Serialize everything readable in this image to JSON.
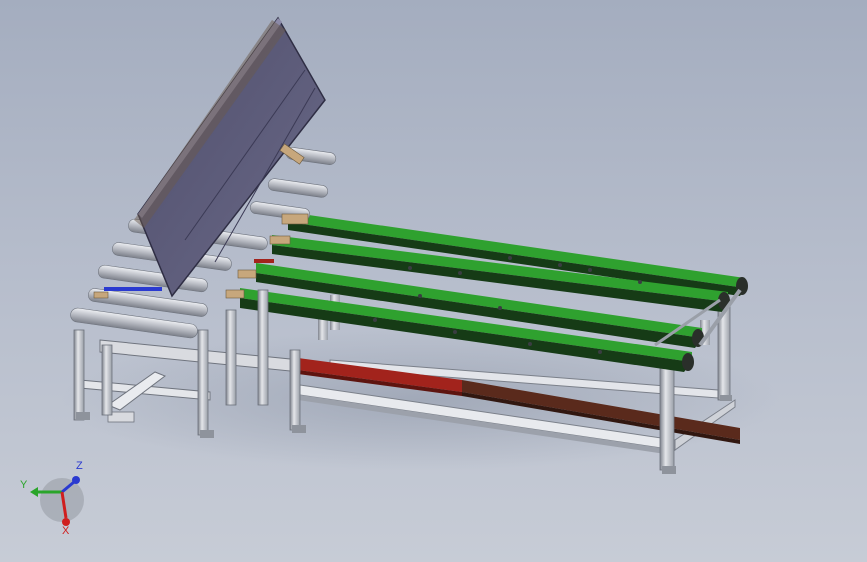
{
  "viewport": {
    "background_top": "#a4adbf",
    "background_bottom": "#c7ccd6"
  },
  "model": {
    "frame_color": "#c9ccd3",
    "frame_shadow": "#8a8f99",
    "panel_color": "#5a5978",
    "belt_color": "#2fa12f",
    "belt_dark": "#163b16",
    "rail_red": "#a2231c",
    "rail_brown": "#5a2a1c",
    "roller_color": "#d2d4d9"
  },
  "triad": {
    "x_label": "X",
    "y_label": "Y",
    "z_label": "Z",
    "x_color": "#d01e1e",
    "y_color": "#2aa52a",
    "z_color": "#2a3ad0"
  }
}
